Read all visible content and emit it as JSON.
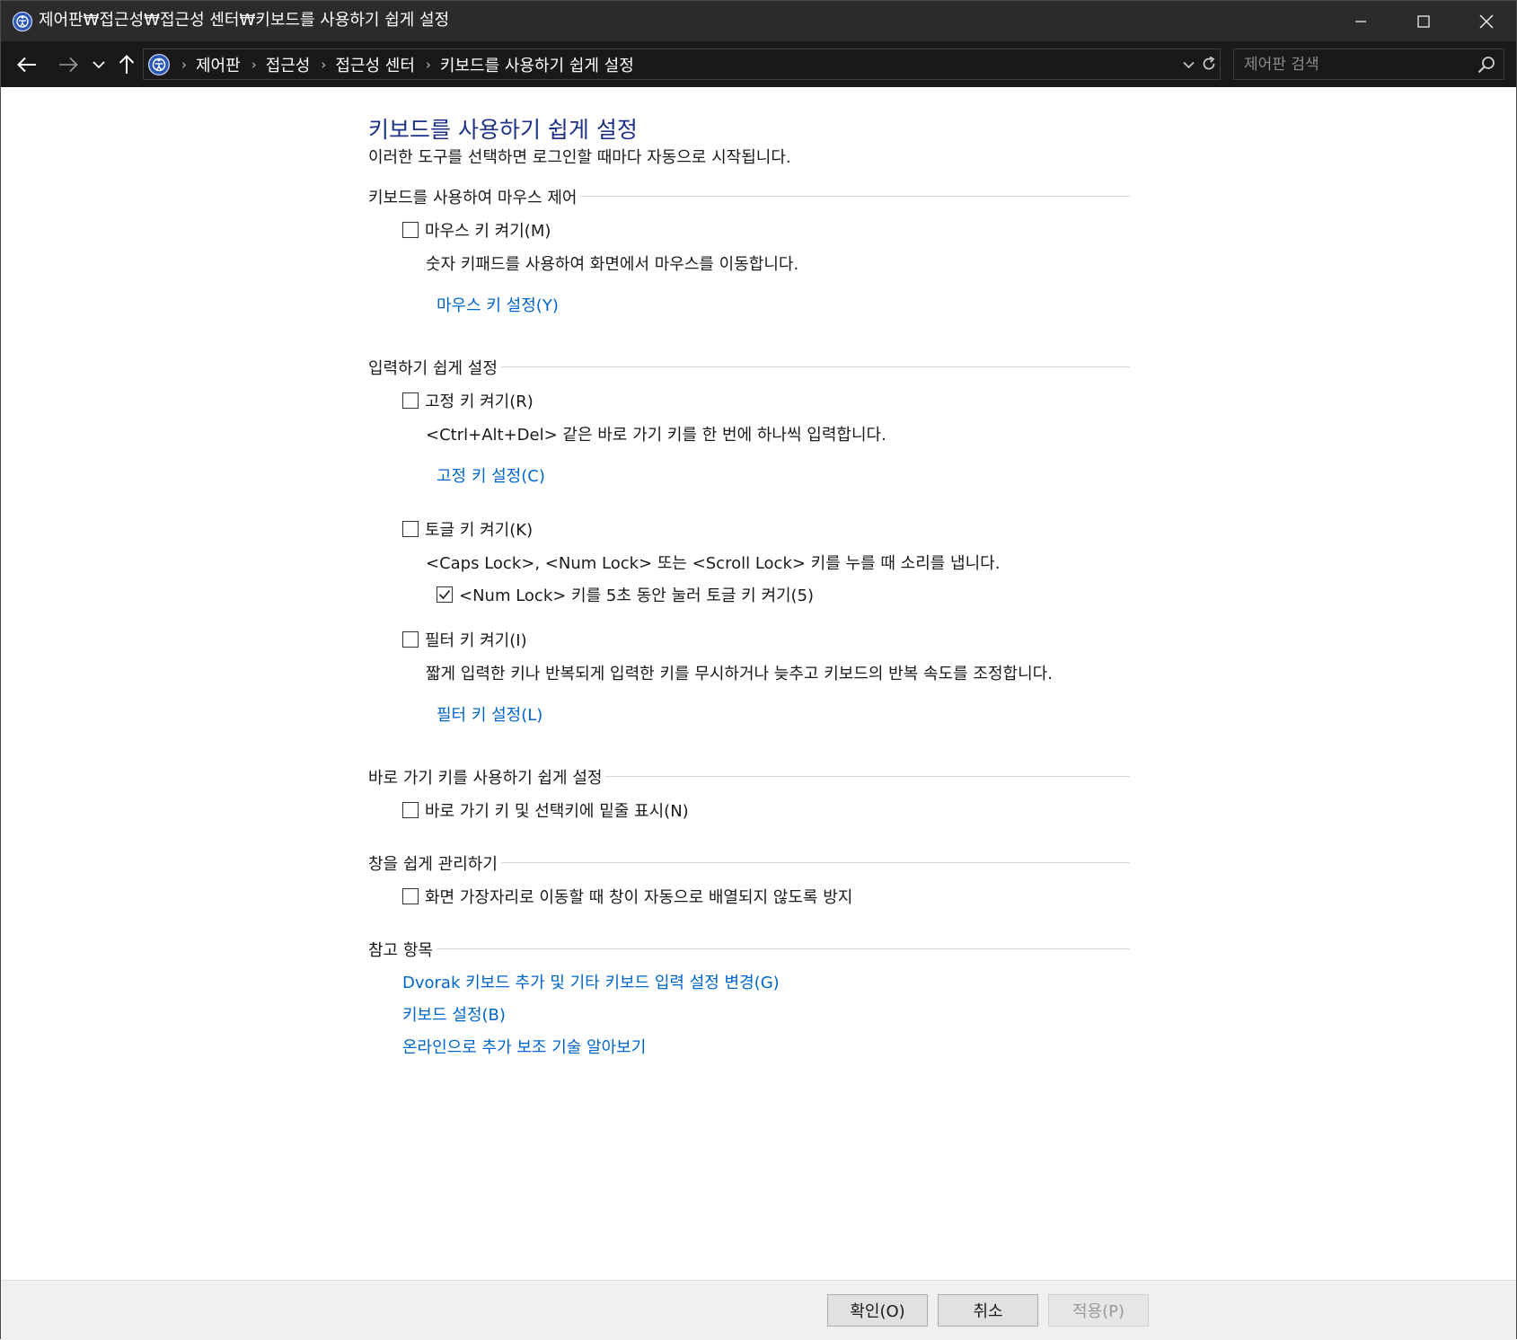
{
  "window": {
    "title": "제어판₩접근성₩접근성 센터₩키보드를 사용하기 쉽게 설정"
  },
  "address_bar": {
    "breadcrumbs": [
      "제어판",
      "접근성",
      "접근성 센터",
      "키보드를 사용하기 쉽게 설정"
    ]
  },
  "search": {
    "placeholder": "제어판 검색"
  },
  "page": {
    "title": "키보드를 사용하기 쉽게 설정",
    "subtitle": "이러한 도구를 선택하면 로그인할 때마다 자동으로 시작됩니다."
  },
  "sections": {
    "mouse": {
      "heading": "키보드를 사용하여 마우스 제어",
      "mouse_keys_label": "마우스 키 켜기(M)",
      "mouse_keys_checked": false,
      "mouse_keys_desc": "숫자 키패드를 사용하여 화면에서 마우스를 이동합니다.",
      "mouse_keys_link": "마우스 키 설정(Y)"
    },
    "typing": {
      "heading": "입력하기 쉽게 설정",
      "sticky_label": "고정 키 켜기(R)",
      "sticky_checked": false,
      "sticky_desc": "<Ctrl+Alt+Del> 같은 바로 가기 키를 한 번에 하나씩 입력합니다.",
      "sticky_link": "고정 키 설정(C)",
      "toggle_label": "토글 키 켜기(K)",
      "toggle_checked": false,
      "toggle_desc": "<Caps Lock>, <Num Lock> 또는 <Scroll Lock> 키를 누를 때 소리를 냅니다.",
      "numlock_label": "<Num Lock> 키를 5초 동안 눌러 토글 키 켜기(5)",
      "numlock_checked": true,
      "filter_label": "필터 키 켜기(I)",
      "filter_checked": false,
      "filter_desc": "짧게 입력한 키나 반복되게 입력한 키를 무시하거나 늦추고 키보드의 반복 속도를 조정합니다.",
      "filter_link": "필터 키 설정(L)"
    },
    "shortcuts": {
      "heading": "바로 가기 키를 사용하기 쉽게 설정",
      "underline_label": "바로 가기 키 및 선택키에 밑줄 표시(N)",
      "underline_checked": false
    },
    "windows": {
      "heading": "창을 쉽게 관리하기",
      "snap_label": "화면 가장자리로 이동할 때 창이 자동으로 배열되지 않도록 방지",
      "snap_checked": false
    },
    "see_also": {
      "heading": "참고 항목",
      "links": [
        "Dvorak 키보드 추가 및 기타 키보드 입력 설정 변경(G)",
        "키보드 설정(B)",
        "온라인으로 추가 보조 기술 알아보기"
      ]
    }
  },
  "footer": {
    "ok_label": "확인(O)",
    "cancel_label": "취소",
    "apply_label": "적용(P)",
    "apply_enabled": false
  },
  "icons": {
    "app": "control-panel-icon",
    "back": "arrow-left-icon",
    "forward": "arrow-right-icon",
    "recent": "chevron-down-icon",
    "up": "arrow-up-icon",
    "refresh": "refresh-icon",
    "search": "search-icon"
  }
}
